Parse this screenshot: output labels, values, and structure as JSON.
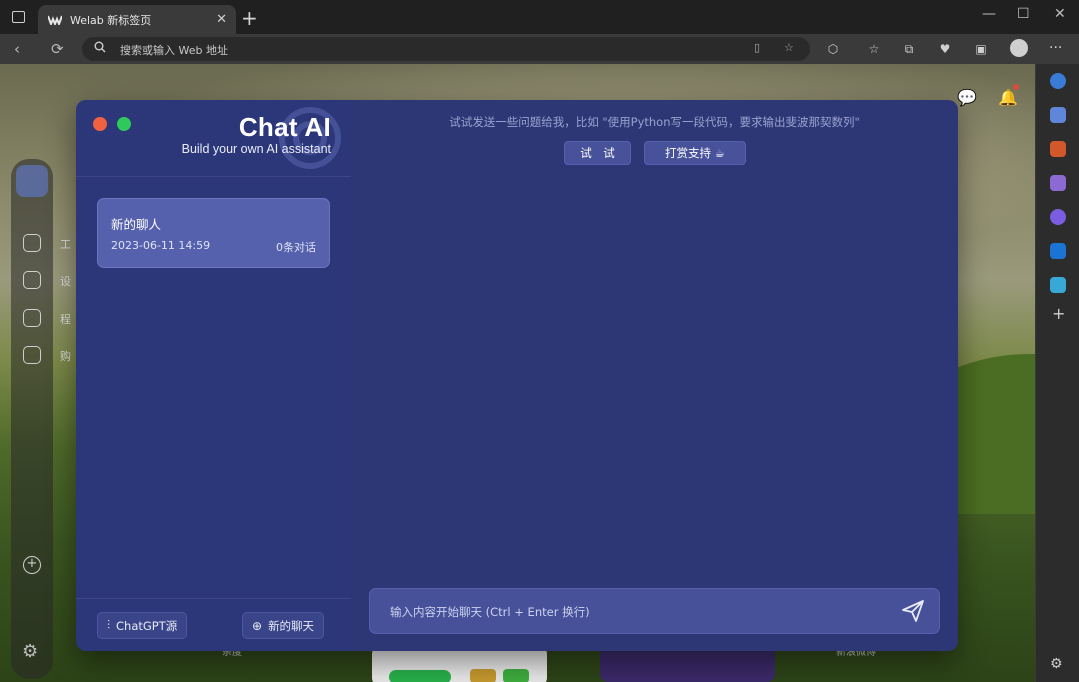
{
  "browser": {
    "tab_title": "Welab 新标签页",
    "tab_close": "✕",
    "new_tab": "+",
    "address_placeholder": "搜索或输入 Web 地址",
    "window_controls": [
      "—",
      "☐",
      "✕"
    ]
  },
  "page": {
    "dock_labels": [
      "工",
      "设",
      "程",
      "购"
    ],
    "bottom_labels": [
      "杂度",
      "新浪微博"
    ]
  },
  "chat": {
    "title": "Chat AI",
    "subtitle": "Build your own AI assistant",
    "hint": "试试发送一些问题给我，比如 \"使用Python写一段代码，要求输出斐波那契数列\"",
    "try_button": "试　试",
    "support_button": "打赏支持 ☕",
    "session": {
      "title": "新的聊人",
      "date": "2023-06-11 14:59",
      "count": "0条对话"
    },
    "source_button": "ChatGPT源",
    "new_chat_button": "新的聊天",
    "input_placeholder": "输入内容开始聊天 (Ctrl + Enter 换行)"
  },
  "colors": {
    "close_dot": "#f0623f",
    "max_dot": "#2ec95a",
    "accent": "#5561ad"
  },
  "icons": [
    "search-icon",
    "send-icon",
    "settings-icon",
    "plus-icon",
    "sliders-icon"
  ]
}
